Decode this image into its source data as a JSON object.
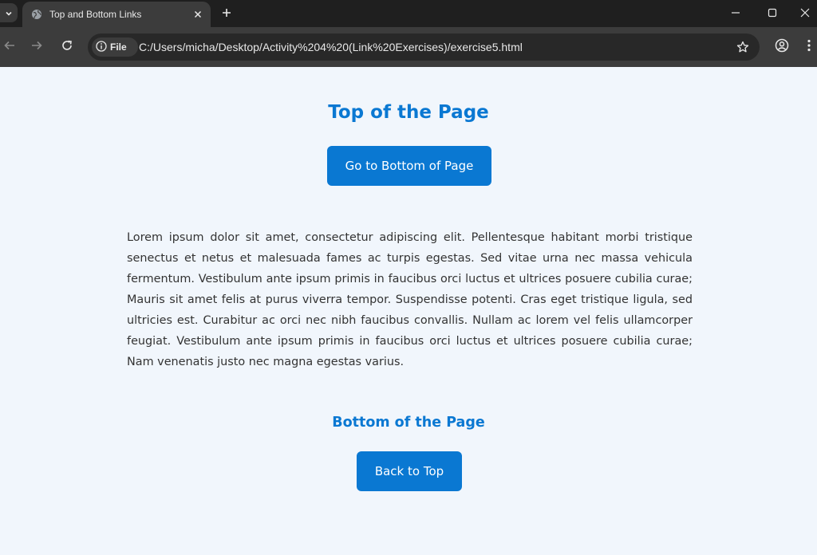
{
  "browser": {
    "tab": {
      "title": "Top and Bottom Links",
      "favicon": "globe-icon",
      "close": "close-icon"
    },
    "new_tab": "plus-icon",
    "window_controls": [
      "minimize-icon",
      "maximize-icon",
      "close-icon"
    ],
    "nav": [
      "back-arrow-icon",
      "forward-arrow-icon",
      "reload-icon"
    ],
    "site_chip": {
      "icon": "info-icon",
      "label": "File"
    },
    "url": "C:/Users/micha/Desktop/Activity%204%20(Link%20Exercises)/exercise5.html",
    "bookmark": "star-icon",
    "profile": "profile-icon",
    "menu": "kebab-menu-icon"
  },
  "page": {
    "top_heading": "Top of the Page",
    "go_bottom_label": "Go to Bottom of Page",
    "paragraph": "Lorem ipsum dolor sit amet, consectetur adipiscing elit. Pellentesque habitant morbi tristique senectus et netus et malesuada fames ac turpis egestas. Sed vitae urna nec massa vehicula fermentum. Vestibulum ante ipsum primis in faucibus orci luctus et ultrices posuere cubilia curae; Mauris sit amet felis at purus viverra tempor. Suspendisse potenti. Cras eget tristique ligula, sed ultricies est. Curabitur ac orci nec nibh faucibus convallis. Nullam ac lorem vel felis ullamcorper feugiat. Vestibulum ante ipsum primis in faucibus orci luctus et ultrices posuere cubilia curae; Nam venenatis justo nec magna egestas varius.",
    "bottom_heading": "Bottom of the Page",
    "back_top_label": "Back to Top"
  },
  "colors": {
    "accent": "#0a78d2",
    "page_background": "#f1f6fc",
    "chrome_dark": "#1f1f1f",
    "chrome_toolbar": "#3c3c3c",
    "text": "#333333"
  }
}
